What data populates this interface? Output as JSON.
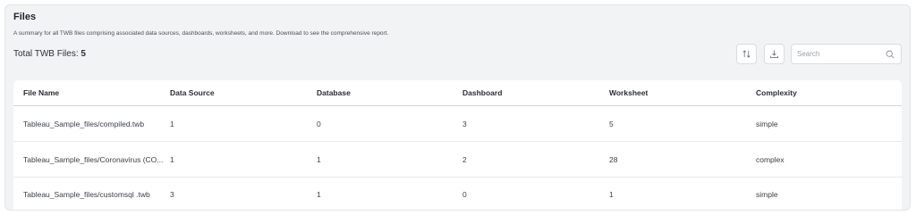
{
  "header": {
    "title": "Files",
    "subtitle": "A summary for all TWB files comprising associated data sources, dashboards, worksheets, and more. Download to see the comprehensive report.",
    "total_label": "Total TWB Files:",
    "total_value": "5"
  },
  "toolbar": {
    "sort_icon": "sort-icon",
    "download_icon": "download-icon",
    "search_placeholder": "Search",
    "search_value": "",
    "search_icon": "search-icon"
  },
  "table": {
    "columns": [
      "File Name",
      "Data Source",
      "Database",
      "Dashboard",
      "Worksheet",
      "Complexity"
    ],
    "rows": [
      [
        "Tableau_Sample_files/compiled.twb",
        "1",
        "0",
        "3",
        "5",
        "simple"
      ],
      [
        "Tableau_Sample_files/Coronavirus (CO...",
        "1",
        "1",
        "2",
        "28",
        "complex"
      ],
      [
        "Tableau_Sample_files/customsql .twb",
        "3",
        "1",
        "0",
        "1",
        "simple"
      ]
    ]
  }
}
